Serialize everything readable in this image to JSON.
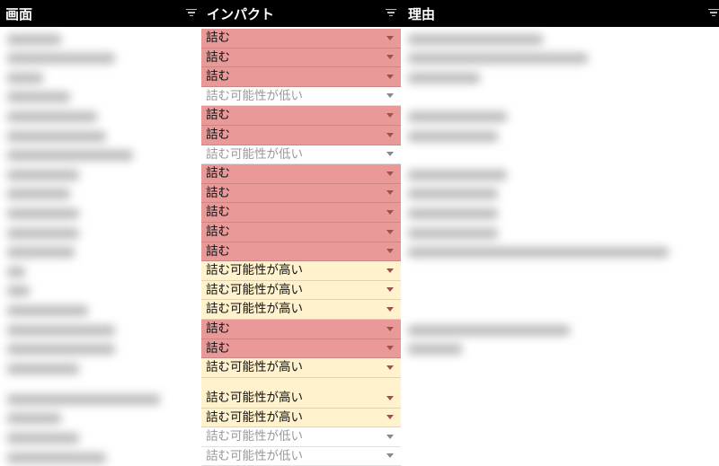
{
  "header": {
    "columns": [
      {
        "label": "画面"
      },
      {
        "label": "インパクト"
      },
      {
        "label": "理由"
      }
    ]
  },
  "colors": {
    "stuck": "#ea9999",
    "high": "#fff2cc",
    "low": "#ffffff",
    "header": "#000000"
  },
  "impact_rows": [
    {
      "value": "詰む",
      "level": "red"
    },
    {
      "value": "詰む",
      "level": "red"
    },
    {
      "value": "詰む",
      "level": "red"
    },
    {
      "value": "詰む可能性が低い",
      "level": "white"
    },
    {
      "value": "詰む",
      "level": "red"
    },
    {
      "value": "詰む",
      "level": "red"
    },
    {
      "value": "詰む可能性が低い",
      "level": "white"
    },
    {
      "value": "詰む",
      "level": "red"
    },
    {
      "value": "詰む",
      "level": "red"
    },
    {
      "value": "詰む",
      "level": "red"
    },
    {
      "value": "詰む",
      "level": "red"
    },
    {
      "value": "詰む",
      "level": "red"
    },
    {
      "value": "詰む可能性が高い",
      "level": "yellow"
    },
    {
      "value": "詰む可能性が高い",
      "level": "yellow"
    },
    {
      "value": "詰む可能性が高い",
      "level": "yellow"
    },
    {
      "value": "詰む",
      "level": "red"
    },
    {
      "value": "詰む",
      "level": "red"
    },
    {
      "value": "詰む可能性が高い",
      "level": "yellow"
    },
    {
      "value": "詰む可能性が高い",
      "level": "yellow",
      "tall": true
    },
    {
      "value": "詰む可能性が高い",
      "level": "yellow"
    },
    {
      "value": "詰む可能性が低い",
      "level": "white"
    },
    {
      "value": "詰む可能性が低い",
      "level": "white"
    }
  ]
}
